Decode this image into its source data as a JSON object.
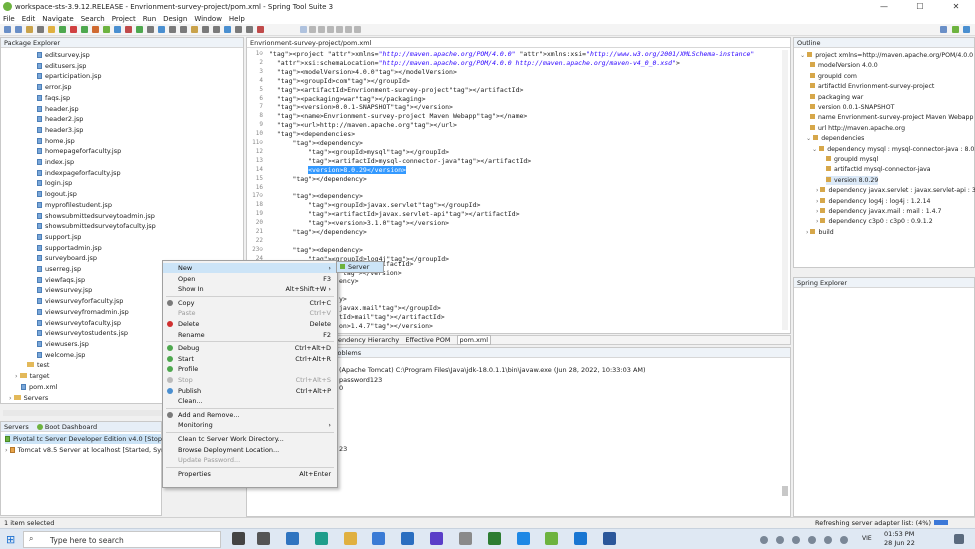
{
  "window": {
    "title": "workspace-sts-3.9.12.RELEASE - Envrionment-survey-project/pom.xml - Spring Tool Suite 3",
    "minimize": "—",
    "maximize": "☐",
    "close": "✕"
  },
  "menu": [
    "File",
    "Edit",
    "Navigate",
    "Search",
    "Project",
    "Run",
    "Design",
    "Window",
    "Help"
  ],
  "package_explorer": {
    "title": "Package Explorer",
    "files": [
      "editsurvey.jsp",
      "editusers.jsp",
      "eparticipation.jsp",
      "error.jsp",
      "faqs.jsp",
      "header.jsp",
      "header2.jsp",
      "header3.jsp",
      "home.jsp",
      "homepageforfaculty.jsp",
      "index.jsp",
      "indexpageforfaculty.jsp",
      "login.jsp",
      "logout.jsp",
      "myprofilestudent.jsp",
      "showsubmittedsurveytoadmin.jsp",
      "showsubmittedsurveytofaculty.jsp",
      "support.jsp",
      "supportadmin.jsp",
      "surveyboard.jsp",
      "userreg.jsp",
      "viewfaqs.jsp",
      "viewsurvey.jsp",
      "viewsurveyforfaculty.jsp",
      "viewsurveyfromadmin.jsp",
      "viewsurveytofaculty.jsp",
      "viewsurveytostudents.jsp",
      "viewusers.jsp",
      "welcome.jsp"
    ],
    "folders": [
      "test",
      "target"
    ],
    "pom": "pom.xml",
    "servers": "Servers"
  },
  "servers_panel": {
    "tabs": [
      "Servers",
      "Boot Dashboard"
    ],
    "items": [
      "Pivotal tc Server Developer Edition v4.0  [Stopp",
      "Tomcat v8.5 Server at localhost  [Started, Synch"
    ]
  },
  "editor": {
    "tab": "Envrionment-survey-project/pom.xml",
    "line_numbers": [
      "1⊝",
      "2",
      "3",
      "4",
      "5",
      "6",
      "7",
      "8",
      "9",
      "10",
      "11⊝",
      "12",
      "13",
      "14",
      "15",
      "16",
      "17⊝",
      "18",
      "19",
      "20",
      "21",
      "22",
      "23⊝",
      "24"
    ],
    "lines": [
      "<project xmlns=\"http://maven.apache.org/POM/4.0.0\" xmlns:xsi=\"http://www.w3.org/2001/XMLSchema-instance\"",
      "  xsi:schemaLocation=\"http://maven.apache.org/POM/4.0.0 http://maven.apache.org/maven-v4_0_0.xsd\">",
      "  <modelVersion>4.0.0</modelVersion>",
      "  <groupId>com</groupId>",
      "  <artifactId>Envrionment-survey-project</artifactId>",
      "  <packaging>war</packaging>",
      "  <version>0.0.1-SNAPSHOT</version>",
      "  <name>Envrionment-survey-project Maven Webapp</name>",
      "  <url>http://maven.apache.org</url>",
      "  <dependencies>",
      "      <dependency>",
      "          <groupId>mysql</groupId>",
      "          <artifactId>mysql-connector-java</artifactId>",
      "          <version>8.0.29</version>",
      "      </dependency>",
      "",
      "      <dependency>",
      "          <groupId>javax.servlet</groupId>",
      "          <artifactId>javax.servlet-api</artifactId>",
      "          <version>3.1.0</version>",
      "      </dependency>",
      "",
      "      <dependency>",
      "          <groupId>log4j</groupId>"
    ],
    "partial_lines": [
      "</artifactId>",
      "</version>",
      "ency>",
      "",
      "y>",
      "javax.mail</groupId>",
      "tId>mail</artifactId>",
      "on>1.4.7</version>"
    ],
    "bottom_tabs": [
      "endency Hierarchy",
      "Effective POM",
      "pom.xml"
    ]
  },
  "outline": {
    "title": "Outline",
    "items": [
      "project xmlns=http://maven.apache.org/POM/4.0.0",
      "modelVersion  4.0.0",
      "groupId  com",
      "artifactId  Envrionment-survey-project",
      "packaging  war",
      "version  0.0.1-SNAPSHOT",
      "name  Envrionment-survey-project Maven Webapp",
      "url  http://maven.apache.org",
      "dependencies",
      "dependency  mysql : mysql-connector-java : 8.0.29",
      "groupId  mysql",
      "artifactId  mysql-connector-java",
      "version  8.0.29",
      "dependency  javax.servlet : javax.servlet-api : 3.1",
      "dependency  log4j : log4j : 1.2.14",
      "dependency  javax.mail : mail : 1.4.7",
      "dependency  c3p0 : c3p0 : 0.9.1.2",
      "build"
    ]
  },
  "spring_explorer": {
    "title": "Spring Explorer"
  },
  "console": {
    "tab": "roblems",
    "path_line": "(Apache Tomcat) C:\\Program Files\\Java\\jdk-18.0.1.1\\bin\\javaw.exe  (Jun 28, 2022, 10:33:03 AM)",
    "output": [
      "password123",
      "0",
      "23"
    ]
  },
  "context_menu": {
    "items": [
      {
        "label": "New",
        "shortcut": "›",
        "highlighted": true
      },
      {
        "label": "Open",
        "shortcut": "F3"
      },
      {
        "label": "Show In",
        "shortcut": "Alt+Shift+W ›"
      },
      {
        "sep": true
      },
      {
        "label": "Copy",
        "shortcut": "Ctrl+C"
      },
      {
        "label": "Paste",
        "shortcut": "Ctrl+V",
        "disabled": true
      },
      {
        "label": "Delete",
        "shortcut": "Delete"
      },
      {
        "label": "Rename",
        "shortcut": "F2"
      },
      {
        "sep": true
      },
      {
        "label": "Debug",
        "shortcut": "Ctrl+Alt+D"
      },
      {
        "label": "Start",
        "shortcut": "Ctrl+Alt+R"
      },
      {
        "label": "Profile",
        "shortcut": ""
      },
      {
        "label": "Stop",
        "shortcut": "Ctrl+Alt+S",
        "disabled": true
      },
      {
        "label": "Publish",
        "shortcut": "Ctrl+Alt+P"
      },
      {
        "label": "Clean...",
        "shortcut": ""
      },
      {
        "sep": true
      },
      {
        "label": "Add and Remove...",
        "shortcut": ""
      },
      {
        "label": "Monitoring",
        "shortcut": "›"
      },
      {
        "sep": true
      },
      {
        "label": "Clean tc Server Work Directory...",
        "shortcut": ""
      },
      {
        "label": "Browse Deployment Location...",
        "shortcut": ""
      },
      {
        "label": "Update Password...",
        "shortcut": "",
        "disabled": true
      },
      {
        "sep": true
      },
      {
        "label": "Properties",
        "shortcut": "Alt+Enter"
      }
    ],
    "submenu": "Server"
  },
  "status": {
    "left": "1 item selected",
    "right": "Refreshing server adapter list: (4%)"
  },
  "taskbar": {
    "search": "Type here to search",
    "time": "01:53 PM",
    "date": "28 Jun 22",
    "lang": "VIE"
  },
  "colors": {
    "menu_highlight": "#cce4f7",
    "selection": "#3399ff",
    "spring_green": "#6db33f"
  }
}
